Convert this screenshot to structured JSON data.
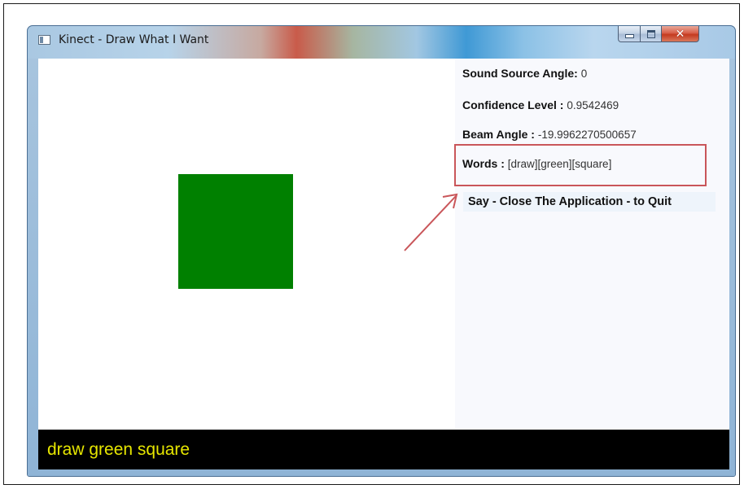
{
  "window": {
    "title": "Kinect - Draw What I Want",
    "caption_buttons": {
      "minimize_icon": "minimize-icon",
      "maximize_icon": "maximize-icon",
      "close_icon": "close-icon",
      "close_glyph": "✕"
    }
  },
  "canvas": {
    "shape": "square",
    "shape_color": "#008000"
  },
  "info": {
    "sound_source_angle": {
      "label": "Sound Source Angle:",
      "value": "0"
    },
    "confidence_level": {
      "label": "Confidence Level :",
      "value": "0.9542469"
    },
    "beam_angle": {
      "label": "Beam Angle :",
      "value": "-19.9962270500657"
    },
    "words": {
      "label": "Words :",
      "value": "[draw][green][square]"
    },
    "quit_instruction": "Say - Close The Application - to Quit"
  },
  "status": {
    "recognized_text": "draw green square",
    "text_color": "#e6e600",
    "background": "#000000"
  },
  "annotation": {
    "color": "#c9565a"
  }
}
